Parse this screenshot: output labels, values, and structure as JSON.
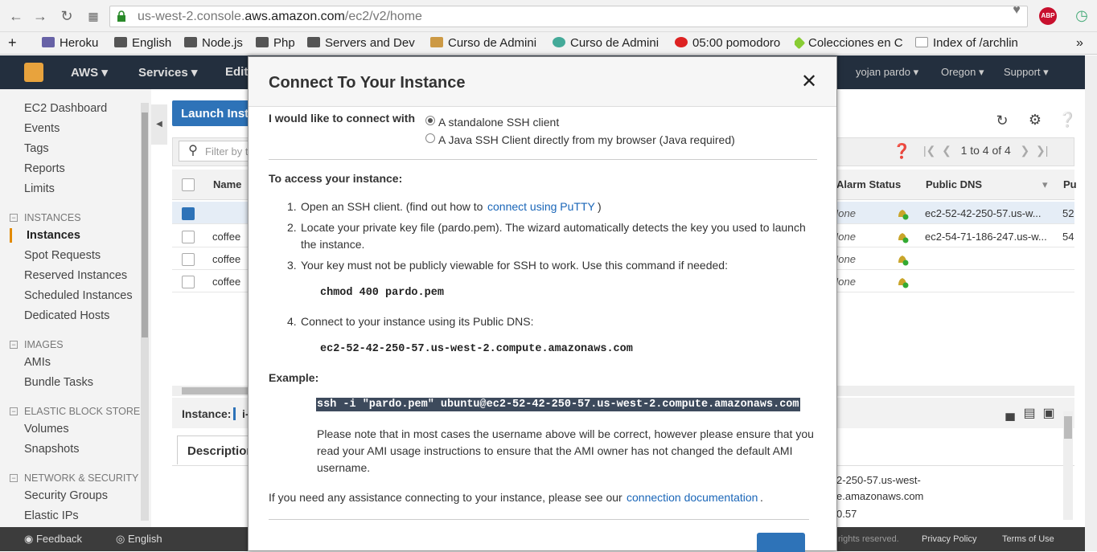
{
  "browser": {
    "url_prefix": "us-west-2.console.",
    "url_domain": "aws.amazon.com",
    "url_path": "/ec2/v2/home",
    "abp_label": "ABP",
    "bookmarks": [
      "Heroku",
      "English",
      "Node.js",
      "Php",
      "Servers and Dev",
      "Curso de Admini",
      "Curso de Admini",
      "05:00 pomodoro",
      "Colecciones en C",
      "Index of /archlin"
    ]
  },
  "aws_nav": {
    "brand": "AWS",
    "services": "Services",
    "edit": "Edit",
    "user": "yojan pardo",
    "region": "Oregon",
    "support": "Support"
  },
  "sidebar": {
    "items_top": [
      "EC2 Dashboard",
      "Events",
      "Tags",
      "Reports",
      "Limits"
    ],
    "sections": [
      {
        "title": "INSTANCES",
        "items": [
          "Instances",
          "Spot Requests",
          "Reserved Instances",
          "Scheduled Instances",
          "Dedicated Hosts"
        ]
      },
      {
        "title": "IMAGES",
        "items": [
          "AMIs",
          "Bundle Tasks"
        ]
      },
      {
        "title": "ELASTIC BLOCK STORE",
        "items": [
          "Volumes",
          "Snapshots"
        ]
      },
      {
        "title": "NETWORK & SECURITY",
        "items": [
          "Security Groups",
          "Elastic IPs"
        ]
      }
    ]
  },
  "toolbar": {
    "launch": "Launch Instance",
    "filter_placeholder": "Filter by tags",
    "pager": "1 to 4 of 4"
  },
  "table": {
    "headers": {
      "name": "Name",
      "alarm": "Alarm Status",
      "dns": "Public DNS",
      "pu": "Pu"
    },
    "rows": [
      {
        "name": "",
        "alarm": "None",
        "dns": "ec2-52-42-250-57.us-w...",
        "pu": "52"
      },
      {
        "name": "coffee",
        "alarm": "None",
        "dns": "ec2-54-71-186-247.us-w...",
        "pu": "54"
      },
      {
        "name": "coffee",
        "alarm": "None",
        "dns": "",
        "pu": ""
      },
      {
        "name": "coffee",
        "alarm": "None",
        "dns": "",
        "pu": ""
      }
    ]
  },
  "detail": {
    "instance_label": "Instance:",
    "instance_id": "i-",
    "tab": "Description",
    "dns_tail1": "2-250-57.us-west-",
    "dns_tail2": "e.amazonaws.com",
    "ip_tail": "0.57"
  },
  "footer": {
    "feedback": "Feedback",
    "language": "English",
    "rights": "rights reserved.",
    "privacy": "Privacy Policy",
    "terms": "Terms of Use"
  },
  "modal": {
    "title": "Connect To Your Instance",
    "connect_with": "I would like to connect with",
    "option1": "A standalone SSH client",
    "option2": "A Java SSH Client directly from my browser (Java required)",
    "access_heading": "To access your instance:",
    "step1_num": "1.",
    "step1": "Open an SSH client. (find out how to",
    "step1_link": "connect using PuTTY",
    "step1_end": ")",
    "step2_num": "2.",
    "step2_a": "Locate your private key file (pardo.pem). The wizard automatically detects the key you used to launch",
    "step2_b": "the instance.",
    "step3_num": "3.",
    "step3": "Your key must not be publicly viewable for SSH to work. Use this command if needed:",
    "chmod": "chmod 400 pardo.pem",
    "step4_num": "4.",
    "step4": "Connect to your instance using its Public DNS:",
    "dns": "ec2-52-42-250-57.us-west-2.compute.amazonaws.com",
    "example": "Example:",
    "ssh_command": "ssh -i \"pardo.pem\" ubuntu@ec2-52-42-250-57.us-west-2.compute.amazonaws.com",
    "note_1": "Please note that in most cases the username above will be correct, however please ensure that you",
    "note_2": "read your AMI usage instructions to ensure that the AMI owner has not changed the default AMI",
    "note_3": "username.",
    "help": "If you need any assistance connecting to your instance, please see our",
    "help_link": "connection documentation",
    "help_end": "."
  }
}
